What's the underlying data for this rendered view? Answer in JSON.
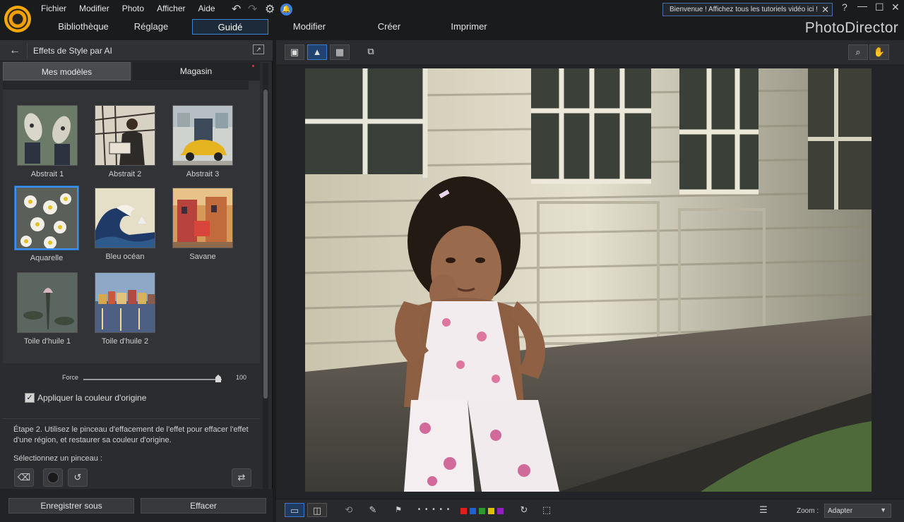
{
  "app": {
    "brand": "PhotoDirector",
    "menu": [
      "Fichier",
      "Modifier",
      "Photo",
      "Afficher",
      "Aide"
    ],
    "welcome_message": "Bienvenue ! Affichez tous les tutoriels vidéo ici !",
    "tabs": [
      {
        "label": "Bibliothèque",
        "active": false
      },
      {
        "label": "Réglage",
        "active": false
      },
      {
        "label": "Guidé",
        "active": true
      },
      {
        "label": "Modifier",
        "active": false
      },
      {
        "label": "Créer",
        "active": false
      },
      {
        "label": "Imprimer",
        "active": false
      }
    ],
    "icons": {
      "undo": "↶",
      "redo": "↷",
      "settings": "⚙",
      "notification": "●",
      "close": "✕",
      "help": "?",
      "minimize": "—",
      "maximize": "☐",
      "window_close": "✕"
    },
    "accent_color": "#3d8ff0"
  },
  "left_panel": {
    "title": "Effets de Style par AI",
    "back_icon": "←",
    "subtabs": {
      "mine": "Mes modèles",
      "store": "Magasin"
    },
    "styles": [
      {
        "label": "Abstrait 1",
        "selected": false,
        "thumb": "sneakers"
      },
      {
        "label": "Abstrait 2",
        "selected": false,
        "thumb": "man-reading"
      },
      {
        "label": "Abstrait 3",
        "selected": false,
        "thumb": "yellow-car"
      },
      {
        "label": "Aquarelle",
        "selected": true,
        "thumb": "flowers"
      },
      {
        "label": "Bleu océan",
        "selected": false,
        "thumb": "great-wave"
      },
      {
        "label": "Savane",
        "selected": false,
        "thumb": "street"
      },
      {
        "label": "Toile d'huile 1",
        "selected": false,
        "thumb": "lotus"
      },
      {
        "label": "Toile d'huile 2",
        "selected": false,
        "thumb": "harbor"
      }
    ],
    "force": {
      "label": "Force",
      "value": "100",
      "fraction": 1.0
    },
    "keep_color": {
      "label": "Appliquer la couleur d'origine",
      "checked": true
    },
    "step_text": "Étape 2. Utilisez le pinceau d'effacement de l'effet pour effacer l'effet d'une région, et restaurer sa couleur d'origine.",
    "brush_label": "Sélectionnez un pinceau :",
    "buttons": {
      "save_as": "Enregistrer sous",
      "clear": "Effacer"
    }
  },
  "workspace": {
    "zoom_label": "Zoom :",
    "zoom_value": "Adapter",
    "color_labels": [
      "#e02020",
      "#2060d0",
      "#2a9a2a",
      "#e0c000",
      "#9020c0"
    ]
  }
}
